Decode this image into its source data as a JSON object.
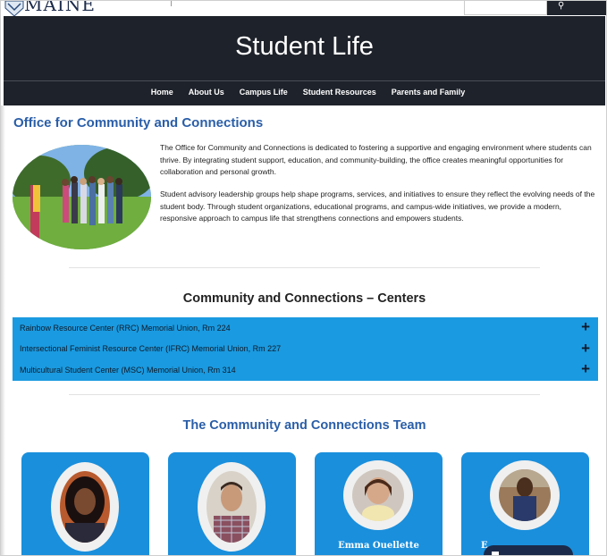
{
  "header": {
    "logo_text": "MAINE",
    "search_icon": "search-icon"
  },
  "hero": {
    "title": "Student Life"
  },
  "nav": {
    "items": [
      {
        "label": "Home"
      },
      {
        "label": "About Us"
      },
      {
        "label": "Campus Life"
      },
      {
        "label": "Student Resources"
      },
      {
        "label": "Parents and Family"
      }
    ]
  },
  "office": {
    "title": "Office for Community and Connections",
    "paragraph1": "The Office for Community and Connections is dedicated to fostering a supportive and engaging environment where students can thrive. By integrating student support, education, and community-building, the office creates meaningful opportunities for collaboration and personal growth.",
    "paragraph2": "Student advisory leadership groups help shape programs, services, and initiatives to ensure they reflect the evolving needs of the student body. Through student organizations, educational programs, and campus-wide initiatives, we provide a modern, responsive approach to campus life that strengthens connections and empowers students."
  },
  "centers": {
    "title": "Community and Connections – Centers",
    "items": [
      {
        "label": "Rainbow Resource Center (RRC) Memorial Union, Rm 224",
        "icon": "plus-icon"
      },
      {
        "label": "Intersectional Feminist Resource Center (IFRC) Memorial Union, Rm 227",
        "icon": "plus-icon"
      },
      {
        "label": "Multicultural Student Center (MSC) Memorial Union, Rm 314",
        "icon": "plus-icon"
      }
    ]
  },
  "team": {
    "title": "The Community and Connections Team",
    "members": [
      {
        "name": ""
      },
      {
        "name": ""
      },
      {
        "name": "Emma Ouellette"
      },
      {
        "name": "E"
      }
    ]
  },
  "colors": {
    "hero_bg": "#1e222a",
    "accent_blue": "#1a9ae0",
    "title_blue": "#2a5ea8"
  }
}
